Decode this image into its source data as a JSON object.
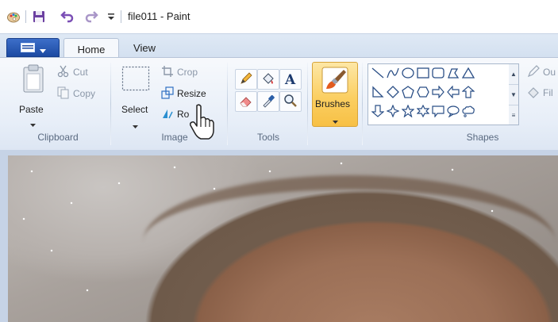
{
  "window": {
    "title": "file011 - Paint"
  },
  "quick_access": {
    "icons": [
      "paint-app-icon",
      "save-icon",
      "undo-icon",
      "redo-icon",
      "customize-dropdown-icon"
    ]
  },
  "tabs": {
    "file_label": "",
    "home": "Home",
    "view": "View"
  },
  "clipboard": {
    "paste": "Paste",
    "cut": "Cut",
    "copy": "Copy",
    "group": "Clipboard"
  },
  "image": {
    "select": "Select",
    "crop": "Crop",
    "resize": "Resize",
    "rotate": "Ro",
    "group": "Image"
  },
  "tools": {
    "group": "Tools"
  },
  "brushes": {
    "label": "Brushes"
  },
  "shapes": {
    "group": "Shapes",
    "outline": "Ou",
    "fill": "Fil"
  },
  "colors": {
    "accent": "#fbcf62",
    "file_tab": "#1c4aa2",
    "ribbon": "#e7eef8"
  }
}
